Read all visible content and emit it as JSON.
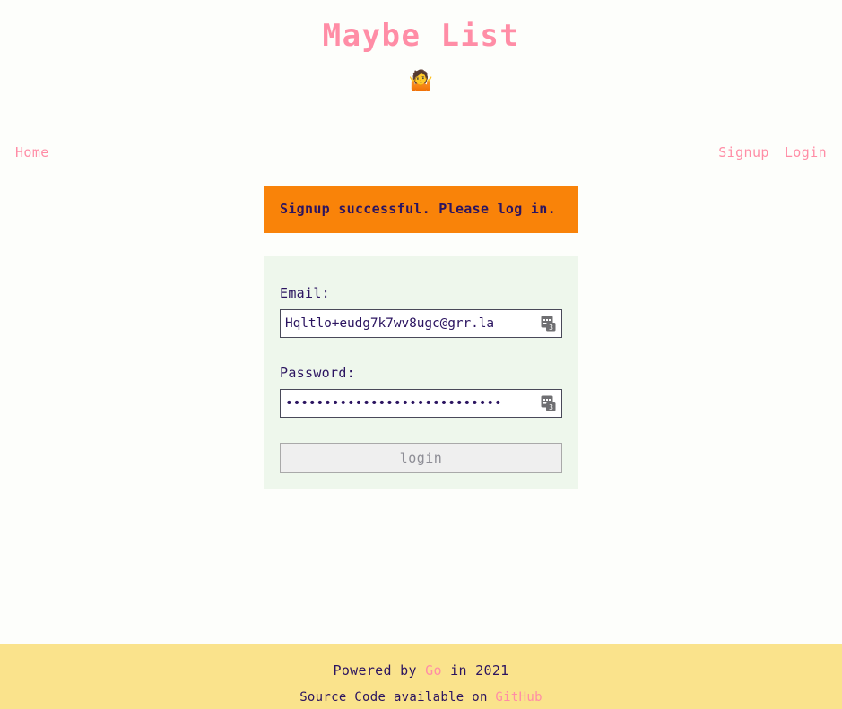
{
  "page": {
    "background_color": "#fdfefb",
    "accent_pink": "#ff8da6",
    "text_navy": "#2b1460"
  },
  "header": {
    "title": "Maybe List",
    "emoji": "🤷",
    "emoji_name": "person-shrugging-emoji"
  },
  "nav": {
    "left": [
      {
        "label": "Home",
        "name": "nav-link-home"
      }
    ],
    "right": [
      {
        "label": "Signup",
        "name": "nav-link-signup"
      },
      {
        "label": "Login",
        "name": "nav-link-login"
      }
    ]
  },
  "alert": {
    "message": "Signup successful. Please log in.",
    "background_color": "#f98309",
    "text_color": "#2b1460"
  },
  "form": {
    "background_color": "#eef7ec",
    "email": {
      "label": "Email:",
      "value": "Hqltlo+eudg7k7wv8ugc@grr.la",
      "placeholder": "",
      "autofill_icon": "password-manager-icon"
    },
    "password": {
      "label": "Password:",
      "value": "••••••••••••••••••••••••••••",
      "placeholder": "",
      "autofill_icon": "password-manager-icon"
    },
    "submit_label": "login"
  },
  "footer": {
    "background_color": "#fae38c",
    "line1_before": "Powered by ",
    "line1_link": "Go",
    "line1_after": " in 2021",
    "line2_before": "Source Code available on ",
    "line2_link": "GitHub"
  }
}
